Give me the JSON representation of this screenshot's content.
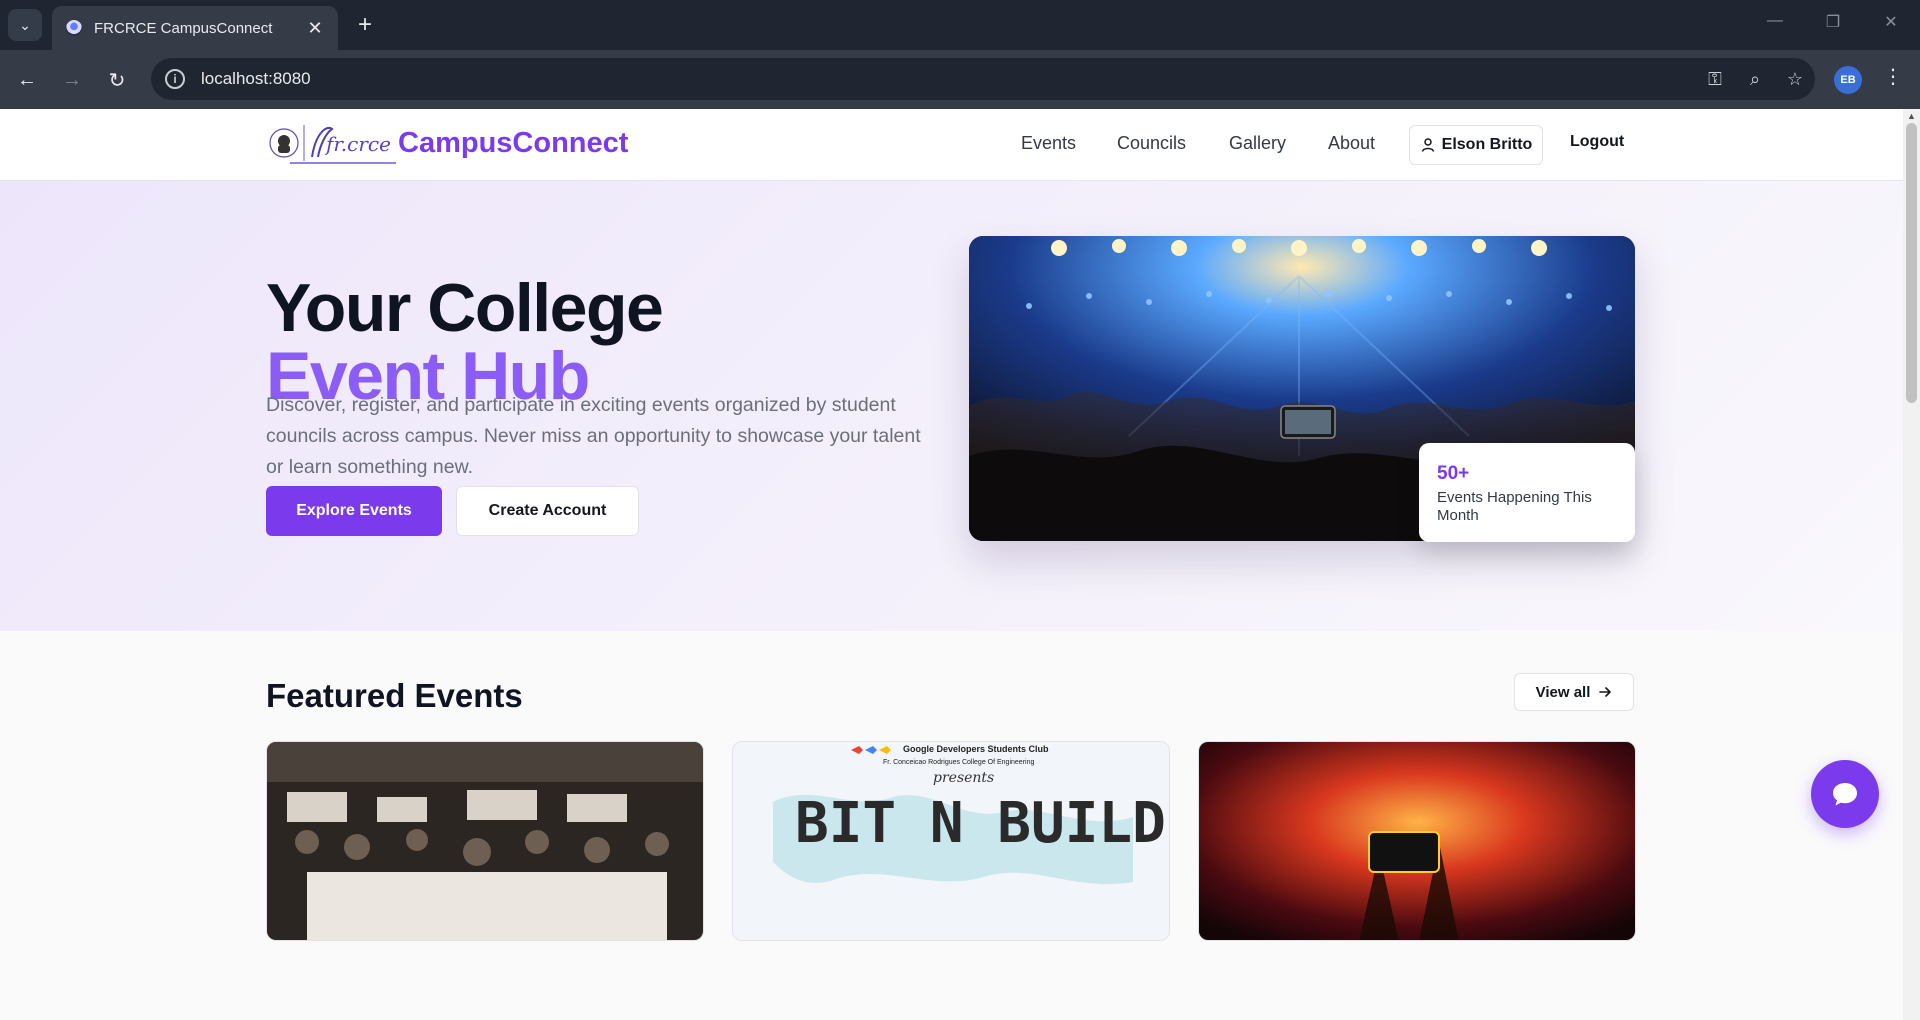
{
  "browser": {
    "tab_title": "FRCRCE CampusConnect",
    "url": "localhost:8080",
    "profile_initials": "EB"
  },
  "site": {
    "brand": "CampusConnect",
    "logo_text": "fr.crce",
    "nav": [
      "Events",
      "Councils",
      "Gallery",
      "About"
    ],
    "user_name": "Elson Britto",
    "logout_label": "Logout"
  },
  "hero": {
    "title_line1": "Your College",
    "title_line2": "Event Hub",
    "description": "Discover, register, and participate in exciting events organized by student councils across campus. Never miss an opportunity to showcase your talent or learn something new.",
    "primary_cta": "Explore Events",
    "secondary_cta": "Create Account",
    "stat_value": "50+",
    "stat_label": "Events Happening This Month"
  },
  "featured": {
    "title": "Featured Events",
    "view_all": "View all",
    "card2_header": "Google Developers Students Club",
    "card2_subheader": "Fr. Conceicao Rodrigues College Of Engineering",
    "card2_presents": "presents",
    "card2_title": "BIT N BUILD"
  },
  "colors": {
    "accent": "#7c3aed",
    "accent_light": "#8b5cf6",
    "heading": "#0f1422"
  },
  "icons": {
    "user": "user-icon",
    "arrow": "arrow-right-icon",
    "chat": "chat-icon"
  }
}
